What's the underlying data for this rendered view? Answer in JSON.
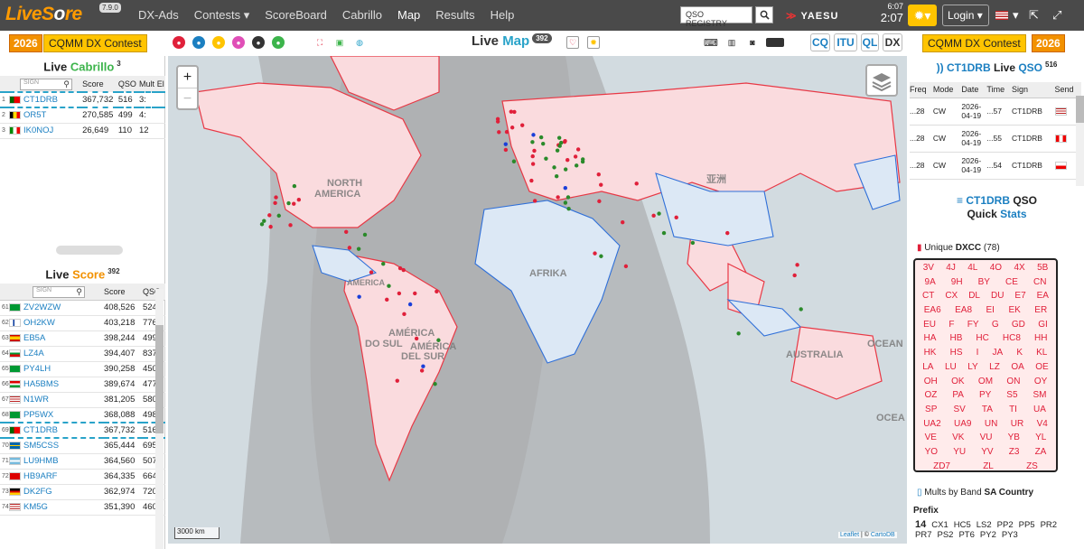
{
  "nav": {
    "logo_a": "Live",
    "logo_b": "S",
    "logo_c": "o",
    "logo_d": "re",
    "version": "7.9.0",
    "menu": [
      "DX-Ads",
      "Contests ▾",
      "ScoreBoard",
      "Cabrillo",
      "Map",
      "Results",
      "Help"
    ],
    "qso_registry": "QSO REGISTRY",
    "brand": "YAESU",
    "time_small": "6:07",
    "time_big": "2:07",
    "login": "Login ▾"
  },
  "contest": {
    "year": "2026",
    "name": "CQMM DX Contest"
  },
  "map_header": {
    "title_a": "Live",
    "title_b": "Map",
    "count": "392",
    "buttons": [
      "CQ",
      "ITU",
      "QL",
      "DX"
    ]
  },
  "cabrillo": {
    "title_a": "Live",
    "title_b": "Cabrillo",
    "count": "3",
    "sign_placeholder": "SIGN",
    "cols": [
      "Score",
      "QSO",
      "Mult",
      "El"
    ],
    "rows": [
      {
        "n": "1",
        "call": "CT1DRB",
        "score": "367,732",
        "qso": "516",
        "mult": "3:",
        "flag": "pt"
      },
      {
        "n": "2",
        "call": "OR5T",
        "score": "270,585",
        "qso": "499",
        "mult": "4:",
        "flag": "be"
      },
      {
        "n": "3",
        "call": "IK0NOJ",
        "score": "26,649",
        "qso": "110",
        "mult": "12",
        "flag": "it"
      }
    ]
  },
  "score": {
    "title_a": "Live",
    "title_b": "Score",
    "count": "392",
    "sign_placeholder": "SIGN",
    "cols": [
      "Score",
      "QSO"
    ],
    "rows": [
      {
        "n": "61",
        "call": "ZV2WZW",
        "score": "408,526",
        "qso": "524",
        "flag": "br"
      },
      {
        "n": "62",
        "call": "OH2KW",
        "score": "403,218",
        "qso": "776",
        "flag": "fi"
      },
      {
        "n": "63",
        "call": "EB5A",
        "score": "398,244",
        "qso": "499",
        "flag": "es"
      },
      {
        "n": "64",
        "call": "LZ4A",
        "score": "394,407",
        "qso": "837",
        "flag": "bg"
      },
      {
        "n": "65",
        "call": "PY4LH",
        "score": "390,258",
        "qso": "450",
        "flag": "br"
      },
      {
        "n": "66",
        "call": "HA5BMS",
        "score": "389,674",
        "qso": "477",
        "flag": "hu"
      },
      {
        "n": "67",
        "call": "N1WR",
        "score": "381,205",
        "qso": "580",
        "flag": "us"
      },
      {
        "n": "68",
        "call": "PP5WX",
        "score": "368,088",
        "qso": "498",
        "flag": "br"
      },
      {
        "n": "69",
        "call": "CT1DRB",
        "score": "367,732",
        "qso": "516",
        "flag": "pt",
        "hl": true
      },
      {
        "n": "70",
        "call": "SM5CSS",
        "score": "365,444",
        "qso": "695",
        "flag": "se"
      },
      {
        "n": "71",
        "call": "LU9HMB",
        "score": "364,560",
        "qso": "507",
        "flag": "ar"
      },
      {
        "n": "72",
        "call": "HB9ARF",
        "score": "364,335",
        "qso": "664",
        "flag": "ch"
      },
      {
        "n": "73",
        "call": "DK2FG",
        "score": "362,974",
        "qso": "720",
        "flag": "de"
      },
      {
        "n": "74",
        "call": "KM5G",
        "score": "351,390",
        "qso": "460",
        "flag": "us"
      }
    ]
  },
  "map": {
    "labels": [
      "NORTH",
      "AMERICA",
      "AMERICA",
      "AMÉRICA",
      "DO SUL",
      "AMÉRICA",
      "DEL SUR",
      "AFRIKA",
      "AUSTRALIA",
      "OCEAN",
      "OCEA",
      "亚洲"
    ],
    "scale": "3000 km",
    "attribution_a": "Leaflet",
    "attribution_b": " | © ",
    "attribution_c": "CartoDB"
  },
  "qso": {
    "call": "CT1DRB",
    "title_b": "Live",
    "title_c": "QSO",
    "count": "516",
    "cols": [
      "Freq",
      "Mode",
      "Date",
      "Time",
      "Sign",
      "Send"
    ],
    "rows": [
      {
        "freq": "...28",
        "mode": "CW",
        "date": "2026-04-19",
        "time": "...57",
        "sign": "CT1DRB",
        "flag": "us"
      },
      {
        "freq": "...28",
        "mode": "CW",
        "date": "2026-04-19",
        "time": "...55",
        "sign": "CT1DRB",
        "flag": "ca"
      },
      {
        "freq": "...28",
        "mode": "CW",
        "date": "2026-04-19",
        "time": "...54",
        "sign": "CT1DRB",
        "flag": "pl"
      }
    ]
  },
  "stats": {
    "call": "CT1DRB",
    "qso": "QSO",
    "quick": "Quick",
    "stats": "Stats",
    "unique": "Unique",
    "dxcc": "DXCC",
    "dxcc_count": "(78)",
    "entities": [
      [
        "3V",
        "4J",
        "4L",
        "4O",
        "4X",
        "5B"
      ],
      [
        "9A",
        "9H",
        "BY",
        "CE",
        "CN"
      ],
      [
        "CT",
        "CX",
        "DL",
        "DU",
        "E7",
        "EA"
      ],
      [
        "EA6",
        "EA8",
        "EI",
        "EK",
        "ER"
      ],
      [
        "EU",
        "F",
        "FY",
        "G",
        "GD",
        "GI"
      ],
      [
        "HA",
        "HB",
        "HC",
        "HC8",
        "HH"
      ],
      [
        "HK",
        "HS",
        "I",
        "JA",
        "K",
        "KL"
      ],
      [
        "LA",
        "LU",
        "LY",
        "LZ",
        "OA",
        "OE"
      ],
      [
        "OH",
        "OK",
        "OM",
        "ON",
        "OY"
      ],
      [
        "OZ",
        "PA",
        "PY",
        "S5",
        "SM"
      ],
      [
        "SP",
        "SV",
        "TA",
        "TI",
        "UA"
      ],
      [
        "UA2",
        "UA9",
        "UN",
        "UR",
        "V4"
      ],
      [
        "VE",
        "VK",
        "VU",
        "YB",
        "YL"
      ],
      [
        "YO",
        "YU",
        "YV",
        "Z3",
        "ZA"
      ],
      [
        "ZD7",
        "ZL",
        "ZS"
      ]
    ],
    "mults_label": "Mults by Band",
    "sa_country": "SA Country",
    "prefix_label": "Prefix",
    "prefix_count": "14",
    "prefixes": [
      "CX1",
      "HC5",
      "LS2",
      "PP2",
      "PP5",
      "PR2",
      "PR7",
      "PS2",
      "PT6",
      "PY2",
      "PY3"
    ]
  },
  "colors": {
    "accent": "#29a3c9",
    "orange": "#f29100",
    "red": "#e0203a"
  }
}
